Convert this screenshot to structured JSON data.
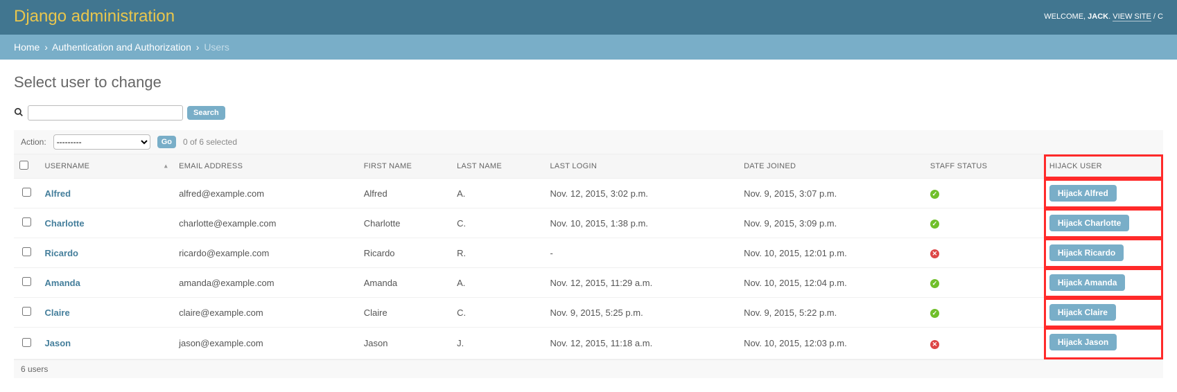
{
  "header": {
    "brand": "Django administration",
    "welcome_prefix": "Welcome, ",
    "username": "Jack",
    "view_site": "View site",
    "trailing": " / C"
  },
  "breadcrumb": {
    "home": "Home",
    "section": "Authentication and Authorization",
    "current": "Users"
  },
  "page_title": "Select user to change",
  "search": {
    "button": "Search",
    "value": ""
  },
  "actions": {
    "label": "Action:",
    "placeholder": "---------",
    "go": "Go",
    "selected_text": "0 of 6 selected"
  },
  "table": {
    "headers": {
      "username": "Username",
      "email": "Email address",
      "first": "First name",
      "last": "Last name",
      "login": "Last login",
      "joined": "Date joined",
      "staff": "Staff status",
      "hijack": "Hijack user"
    },
    "rows": [
      {
        "username": "Alfred",
        "email": "alfred@example.com",
        "first": "Alfred",
        "last": "A.",
        "login": "Nov. 12, 2015, 3:02 p.m.",
        "joined": "Nov. 9, 2015, 3:07 p.m.",
        "staff": true,
        "hijack": "Hijack Alfred"
      },
      {
        "username": "Charlotte",
        "email": "charlotte@example.com",
        "first": "Charlotte",
        "last": "C.",
        "login": "Nov. 10, 2015, 1:38 p.m.",
        "joined": "Nov. 9, 2015, 3:09 p.m.",
        "staff": true,
        "hijack": "Hijack Charlotte"
      },
      {
        "username": "Ricardo",
        "email": "ricardo@example.com",
        "first": "Ricardo",
        "last": "R.",
        "login": "-",
        "joined": "Nov. 10, 2015, 12:01 p.m.",
        "staff": false,
        "hijack": "Hijack Ricardo"
      },
      {
        "username": "Amanda",
        "email": "amanda@example.com",
        "first": "Amanda",
        "last": "A.",
        "login": "Nov. 12, 2015, 11:29 a.m.",
        "joined": "Nov. 10, 2015, 12:04 p.m.",
        "staff": true,
        "hijack": "Hijack Amanda"
      },
      {
        "username": "Claire",
        "email": "claire@example.com",
        "first": "Claire",
        "last": "C.",
        "login": "Nov. 9, 2015, 5:25 p.m.",
        "joined": "Nov. 9, 2015, 5:22 p.m.",
        "staff": true,
        "hijack": "Hijack Claire"
      },
      {
        "username": "Jason",
        "email": "jason@example.com",
        "first": "Jason",
        "last": "J.",
        "login": "Nov. 12, 2015, 11:18 a.m.",
        "joined": "Nov. 10, 2015, 12:03 p.m.",
        "staff": false,
        "hijack": "Hijack Jason"
      }
    ]
  },
  "paginator": {
    "text": "6 users"
  },
  "icons": {
    "check": "✓",
    "cross": "✕"
  }
}
